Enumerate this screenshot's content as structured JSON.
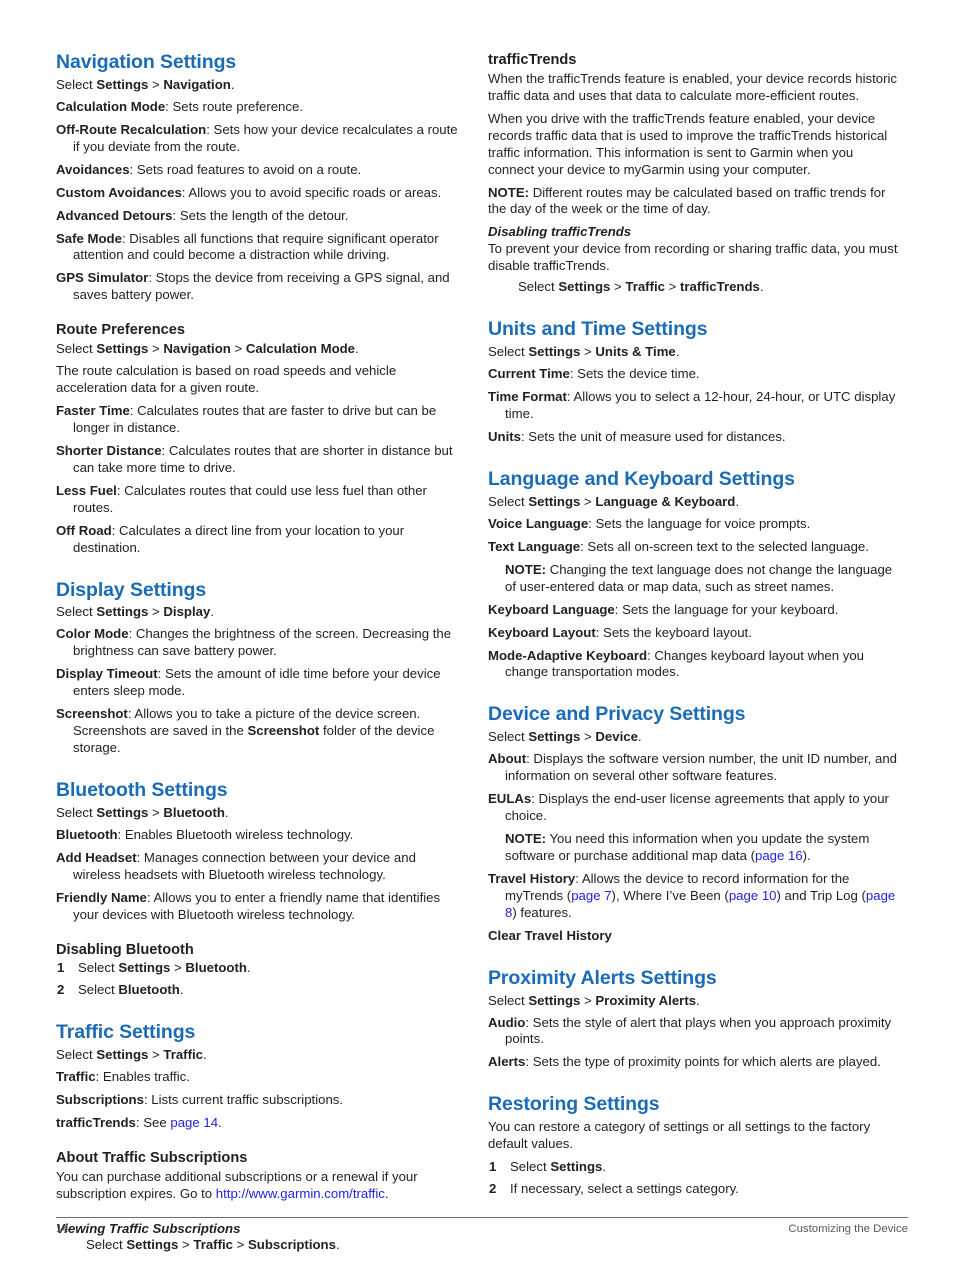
{
  "document": {
    "page_number": "14",
    "footer_section": "Customizing the Device",
    "heading_color": "#1b6cb5",
    "link_color": "#2222dd",
    "text_color": "#231f20"
  },
  "left_column": {
    "navigation_settings": {
      "heading": "Navigation Settings",
      "select_prefix": "Select ",
      "select_settings": "Settings",
      "sep": " > ",
      "select_target": "Navigation",
      "period": ".",
      "items": [
        {
          "term": "Calculation Mode",
          "desc": ": Sets route preference."
        },
        {
          "term": "Off-Route Recalculation",
          "desc": ": Sets how your device recalculates a route if you deviate from the route."
        },
        {
          "term": "Avoidances",
          "desc": ": Sets road features to avoid on a route."
        },
        {
          "term": "Custom Avoidances",
          "desc": ": Allows you to avoid specific roads or areas."
        },
        {
          "term": "Advanced Detours",
          "desc": ": Sets the length of the detour."
        },
        {
          "term": "Safe Mode",
          "desc": ": Disables all functions that require significant operator attention and could become a distraction while driving."
        },
        {
          "term": "GPS Simulator",
          "desc": ": Stops the device from receiving a GPS signal, and saves battery power."
        }
      ]
    },
    "route_preferences": {
      "heading": "Route Preferences",
      "select_prefix": "Select ",
      "select_settings": "Settings",
      "sep1": " > ",
      "select_mid": "Navigation",
      "sep2": " > ",
      "select_target": "Calculation Mode",
      "period": ".",
      "intro": "The route calculation is based on road speeds and vehicle acceleration data for a given route.",
      "items": [
        {
          "term": "Faster Time",
          "desc": ": Calculates routes that are faster to drive but can be longer in distance."
        },
        {
          "term": "Shorter Distance",
          "desc": ": Calculates routes that are shorter in distance but can take more time to drive."
        },
        {
          "term": "Less Fuel",
          "desc": ": Calculates routes that could use less fuel than other routes."
        },
        {
          "term": "Off Road",
          "desc": ": Calculates a direct line from your location to your destination."
        }
      ]
    },
    "display_settings": {
      "heading": "Display Settings",
      "select_prefix": "Select ",
      "select_settings": "Settings",
      "sep": " > ",
      "select_target": "Display",
      "period": ".",
      "items": [
        {
          "term": "Color Mode",
          "desc": ": Changes the brightness of the screen. Decreasing the brightness can save battery power."
        },
        {
          "term": "Display Timeout",
          "desc": ": Sets the amount of idle time before your device enters sleep mode."
        }
      ],
      "screenshot_term": "Screenshot",
      "screenshot_desc_1": ": Allows you to take a picture of the device screen. Screenshots are saved in the ",
      "screenshot_folder": "Screenshot",
      "screenshot_desc_2": " folder of the device storage."
    },
    "bluetooth_settings": {
      "heading": "Bluetooth Settings",
      "select_prefix": "Select ",
      "select_settings": "Settings",
      "sep": " > ",
      "select_target": "Bluetooth",
      "period": ".",
      "items": [
        {
          "term": "Bluetooth",
          "desc": ": Enables Bluetooth wireless technology."
        },
        {
          "term": "Add Headset",
          "desc": ": Manages connection between your device and wireless headsets with Bluetooth wireless technology."
        },
        {
          "term": "Friendly Name",
          "desc": ": Allows you to enter a friendly name that identifies your devices with Bluetooth wireless technology."
        }
      ]
    },
    "disabling_bluetooth": {
      "heading": "Disabling Bluetooth",
      "step1_prefix": "Select ",
      "step1_settings": "Settings",
      "step1_sep": " > ",
      "step1_target": "Bluetooth",
      "step1_period": ".",
      "step2_prefix": "Select ",
      "step2_target": "Bluetooth",
      "step2_period": "."
    },
    "traffic_settings": {
      "heading": "Traffic Settings",
      "select_prefix": "Select ",
      "select_settings": "Settings",
      "sep": " > ",
      "select_target": "Traffic",
      "period": ".",
      "items": [
        {
          "term": "Traffic",
          "desc": ": Enables traffic."
        },
        {
          "term": "Subscriptions",
          "desc": ": Lists current traffic subscriptions."
        }
      ],
      "trends_term": "trafficTrends",
      "trends_desc": ": See ",
      "trends_link": "page 14",
      "trends_period": "."
    },
    "about_traffic_subscriptions": {
      "heading": "About Traffic Subscriptions",
      "body_1": "You can purchase additional subscriptions or a renewal if your subscription expires. Go to ",
      "url": "http://www.garmin.com/traffic",
      "body_2": "."
    },
    "viewing_traffic_subscriptions": {
      "heading": "Viewing Traffic Subscriptions",
      "step_prefix": "Select ",
      "step_settings": "Settings",
      "step_sep1": " > ",
      "step_mid": "Traffic",
      "step_sep2": " > ",
      "step_target": "Subscriptions",
      "step_period": "."
    }
  },
  "right_column": {
    "traffic_trends": {
      "heading": "trafficTrends",
      "para_1": "When the trafficTrends feature is enabled, your device records historic traffic data and uses that data to calculate more-efficient routes.",
      "para_2": "When you drive with the trafficTrends feature enabled, your device records traffic data that is used to improve the trafficTrends historical traffic information. This information is sent to Garmin when you connect your device to myGarmin using your computer.",
      "note_label": "NOTE:",
      "note_text": " Different routes may be calculated based on traffic trends for the day of the week or the time of day."
    },
    "disabling_traffic_trends": {
      "heading": "Disabling trafficTrends",
      "body": "To prevent your device from recording or sharing traffic data, you must disable trafficTrends.",
      "step_prefix": "Select ",
      "step_settings": "Settings",
      "step_sep1": " > ",
      "step_mid": "Traffic",
      "step_sep2": " > ",
      "step_target": "trafficTrends",
      "step_period": "."
    },
    "units_and_time": {
      "heading": "Units and Time Settings",
      "select_prefix": "Select ",
      "select_settings": "Settings",
      "sep": " > ",
      "select_target": "Units & Time",
      "period": ".",
      "items": [
        {
          "term": "Current Time",
          "desc": ": Sets the device time."
        },
        {
          "term": "Time Format",
          "desc": ": Allows you to select a 12-hour, 24-hour, or UTC display time."
        },
        {
          "term": "Units",
          "desc": ": Sets the unit of measure used for distances."
        }
      ]
    },
    "language_and_keyboard": {
      "heading": "Language and Keyboard Settings",
      "select_prefix": "Select ",
      "select_settings": "Settings",
      "sep": " > ",
      "select_target": "Language & Keyboard",
      "period": ".",
      "items_before_note": [
        {
          "term": "Voice Language",
          "desc": ": Sets the language for voice prompts."
        },
        {
          "term": "Text Language",
          "desc": ": Sets all on-screen text to the selected language."
        }
      ],
      "note_label": "NOTE:",
      "note_text": " Changing the text language does not change the language of user-entered data or map data, such as street names.",
      "items_after_note": [
        {
          "term": "Keyboard Language",
          "desc": ": Sets the language for your keyboard."
        },
        {
          "term": "Keyboard Layout",
          "desc": ": Sets the keyboard layout."
        },
        {
          "term": "Mode-Adaptive Keyboard",
          "desc": ": Changes keyboard layout when you change transportation modes."
        }
      ]
    },
    "device_and_privacy": {
      "heading": "Device and Privacy Settings",
      "select_prefix": "Select ",
      "select_settings": "Settings",
      "sep": " > ",
      "select_target": "Device",
      "period": ".",
      "about_term": "About",
      "about_desc": ": Displays the software version number, the unit ID number, and information on several other software features.",
      "eulas_term": "EULAs",
      "eulas_desc": ": Displays the end-user license agreements that apply to your choice.",
      "note_label": "NOTE:",
      "note_text_1": " You need this information when you update the system software or purchase additional map data (",
      "note_link": "page 16",
      "note_text_2": ").",
      "travel_history_term": "Travel History",
      "travel_history_1": ": Allows the device to record information for the myTrends (",
      "travel_history_link_1": "page 7",
      "travel_history_2": "), Where I’ve Been (",
      "travel_history_link_2": "page 10",
      "travel_history_3": ") and Trip Log (",
      "travel_history_link_3": "page 8",
      "travel_history_4": ") features.",
      "clear_travel_history": "Clear Travel History"
    },
    "proximity_alerts": {
      "heading": "Proximity Alerts Settings",
      "select_prefix": "Select ",
      "select_settings": "Settings",
      "sep": " > ",
      "select_target": "Proximity Alerts",
      "period": ".",
      "items": [
        {
          "term": "Audio",
          "desc": ": Sets the style of alert that plays when you approach proximity points."
        },
        {
          "term": "Alerts",
          "desc": ": Sets the type of proximity points for which alerts are played."
        }
      ]
    },
    "restoring_settings": {
      "heading": "Restoring Settings",
      "intro": "You can restore a category of settings or all settings to the factory default values.",
      "step1_prefix": "Select ",
      "step1_target": "Settings",
      "step1_period": ".",
      "step2": "If necessary, select a settings category."
    }
  }
}
